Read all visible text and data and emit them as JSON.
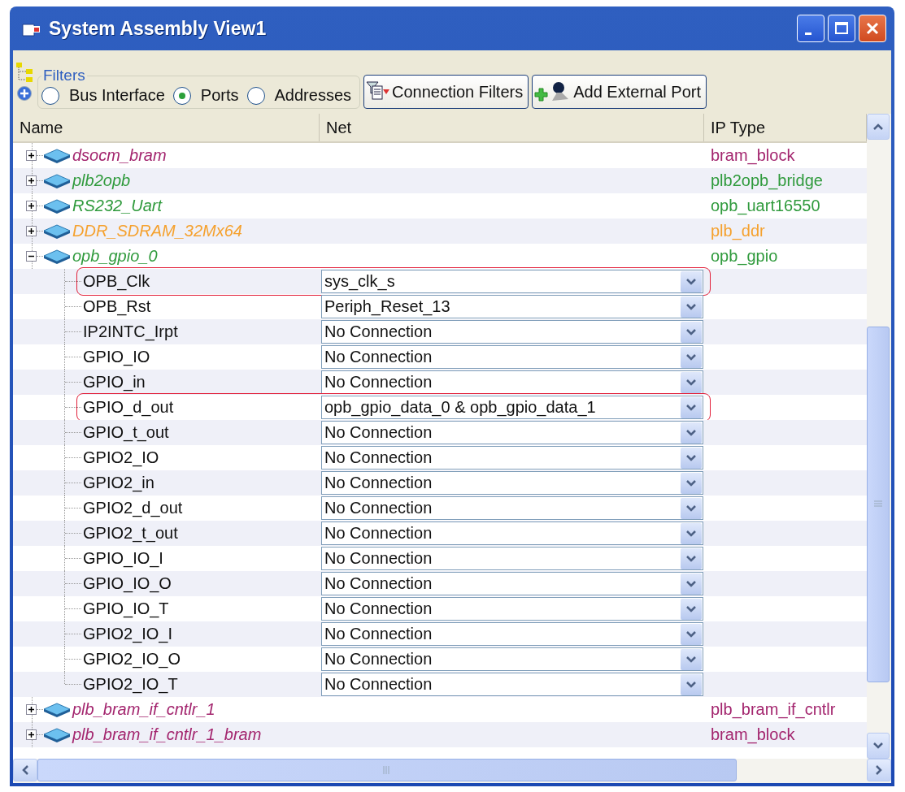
{
  "window": {
    "title": "System Assembly View1"
  },
  "filters": {
    "label": "Filters",
    "options": [
      {
        "label": "Bus Interface",
        "selected": false
      },
      {
        "label": "Ports",
        "selected": true
      },
      {
        "label": "Addresses",
        "selected": false
      }
    ]
  },
  "buttons": [
    "Connection Filters",
    "Add External Port"
  ],
  "table": {
    "columns": [
      "Name",
      "Net",
      "IP Type"
    ],
    "rows": [
      {
        "name": "dsocm_bram",
        "ip_type": "bram_block",
        "color": "#a3256e",
        "expanded": false
      },
      {
        "name": "plb2opb",
        "ip_type": "plb2opb_bridge",
        "color": "#2f9a3c",
        "expanded": false
      },
      {
        "name": "RS232_Uart",
        "ip_type": "opb_uart16550",
        "color": "#2f9a3c",
        "expanded": false
      },
      {
        "name": "DDR_SDRAM_32Mx64",
        "ip_type": "plb_ddr",
        "color": "#f5a12e",
        "expanded": false
      },
      {
        "name": "opb_gpio_0",
        "ip_type": "opb_gpio",
        "color": "#2f9a3c",
        "expanded": true,
        "children": [
          {
            "name": "OPB_Clk",
            "net": "sys_clk_s",
            "highlighted": true
          },
          {
            "name": "OPB_Rst",
            "net": "Periph_Reset_13",
            "highlighted": false
          },
          {
            "name": "IP2INTC_Irpt",
            "net": "No Connection",
            "highlighted": false
          },
          {
            "name": "GPIO_IO",
            "net": "No Connection",
            "highlighted": false
          },
          {
            "name": "GPIO_in",
            "net": "No Connection",
            "highlighted": false
          },
          {
            "name": "GPIO_d_out",
            "net": "opb_gpio_data_0 & opb_gpio_data_1",
            "highlighted": true
          },
          {
            "name": "GPIO_t_out",
            "net": "No Connection",
            "highlighted": false
          },
          {
            "name": "GPIO2_IO",
            "net": "No Connection",
            "highlighted": false
          },
          {
            "name": "GPIO2_in",
            "net": "No Connection",
            "highlighted": false
          },
          {
            "name": "GPIO2_d_out",
            "net": "No Connection",
            "highlighted": false
          },
          {
            "name": "GPIO2_t_out",
            "net": "No Connection",
            "highlighted": false
          },
          {
            "name": "GPIO_IO_I",
            "net": "No Connection",
            "highlighted": false
          },
          {
            "name": "GPIO_IO_O",
            "net": "No Connection",
            "highlighted": false
          },
          {
            "name": "GPIO_IO_T",
            "net": "No Connection",
            "highlighted": false
          },
          {
            "name": "GPIO2_IO_I",
            "net": "No Connection",
            "highlighted": false
          },
          {
            "name": "GPIO2_IO_O",
            "net": "No Connection",
            "highlighted": false
          },
          {
            "name": "GPIO2_IO_T",
            "net": "No Connection",
            "highlighted": false
          }
        ]
      },
      {
        "name": "plb_bram_if_cntlr_1",
        "ip_type": "plb_bram_if_cntlr",
        "color": "#a3256e",
        "expanded": false
      },
      {
        "name": "plb_bram_if_cntlr_1_bram",
        "ip_type": "bram_block",
        "color": "#a3256e",
        "expanded": false
      }
    ]
  }
}
